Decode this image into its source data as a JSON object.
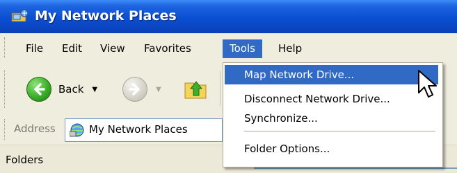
{
  "window": {
    "title": "My Network Places"
  },
  "menu": {
    "items": [
      {
        "label": "File"
      },
      {
        "label": "Edit"
      },
      {
        "label": "View"
      },
      {
        "label": "Favorites"
      },
      {
        "label": "Tools",
        "active": true
      },
      {
        "label": "Help"
      }
    ]
  },
  "toolbar": {
    "back_label": "Back"
  },
  "address": {
    "label": "Address",
    "value": "My Network Places"
  },
  "folders": {
    "label": "Folders"
  },
  "tools_menu": {
    "items": [
      {
        "label": "Map Network Drive...",
        "highlighted": true
      },
      {
        "label": "Disconnect Network Drive..."
      },
      {
        "label": "Synchronize..."
      },
      {
        "label": "Folder Options..."
      }
    ]
  },
  "colors": {
    "title_bar": "#0a4fd2",
    "menu_highlight": "#316ac5",
    "toolbar_bg": "#efedde"
  },
  "icons": [
    "network-places-icon",
    "back-arrow-icon",
    "forward-arrow-icon",
    "up-folder-icon",
    "dropdown-arrow-icon",
    "mouse-pointer-icon"
  ]
}
